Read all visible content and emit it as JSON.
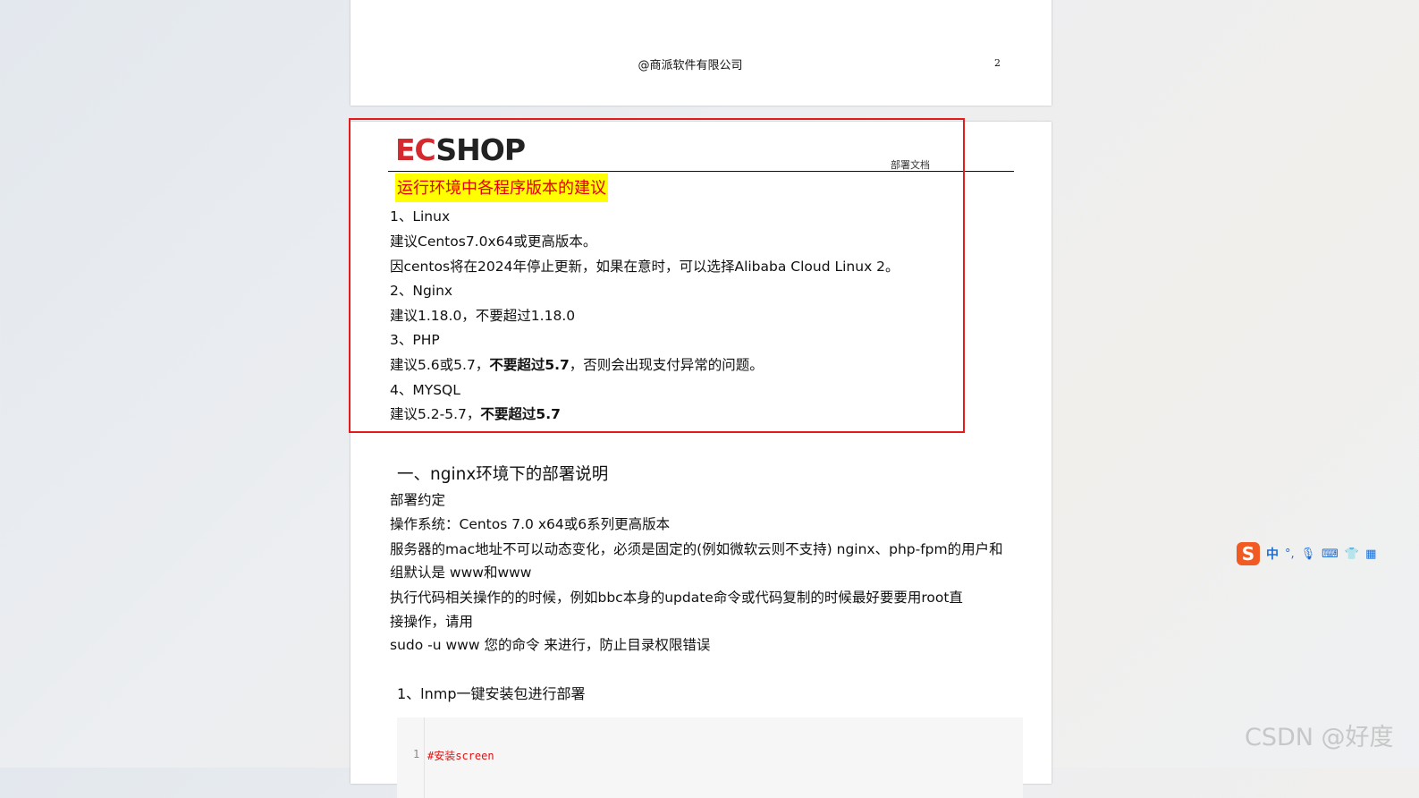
{
  "prev_page": {
    "footer_text": "@商派软件有限公司",
    "page_number": "2"
  },
  "header": {
    "logo_ec": "EC",
    "logo_shop": "SHOP",
    "doc_label": "部署文档"
  },
  "recommend": {
    "title": "运行环境中各程序版本的建议",
    "linux_heading": "1、Linux",
    "linux_line1": "建议Centos7.0x64或更高版本。",
    "linux_line2": "因centos将在2024年停止更新，如果在意时，可以选择Alibaba Cloud Linux 2。",
    "nginx_heading": "2、Nginx",
    "nginx_line": "建议1.18.0，不要超过1.18.0",
    "php_heading": "3、PHP",
    "php_prefix": "建议5.6或5.7，",
    "php_bold": "不要超过5.7",
    "php_suffix": "，否则会出现支付异常的问题。",
    "mysql_heading": "4、MYSQL",
    "mysql_prefix": "建议5.2-5.7，",
    "mysql_bold": "不要超过5.7"
  },
  "section": {
    "heading": "一、nginx环境下的部署说明",
    "p1": "部署约定",
    "p2": "操作系统：Centos 7.0 x64或6系列更高版本",
    "p3a": "服务器的mac地址不可以动态变化，必须是固定的(例如微软云则不支持) nginx、php-fpm的用户和",
    "p3b": "组默认是 www和www",
    "p4a": "执行代码相关操作的的时候，例如bbc本身的update命令或代码复制的时候最好要要用root直",
    "p4b": "接操作，请用",
    "p5": "sudo -u www 您的命令 来进行，防止目录权限错误",
    "sub_heading": "1、lnmp一键安装包进行部署"
  },
  "code": {
    "line_number": "1",
    "line_text": "#安装screen"
  },
  "ime": {
    "logo": "S",
    "lang": "中"
  },
  "watermark": "CSDN @好度",
  "colors": {
    "highlight": "#ffff00",
    "title_red": "#e30000",
    "box_red": "#e31b1b",
    "brand_red": "#d42a2f"
  }
}
